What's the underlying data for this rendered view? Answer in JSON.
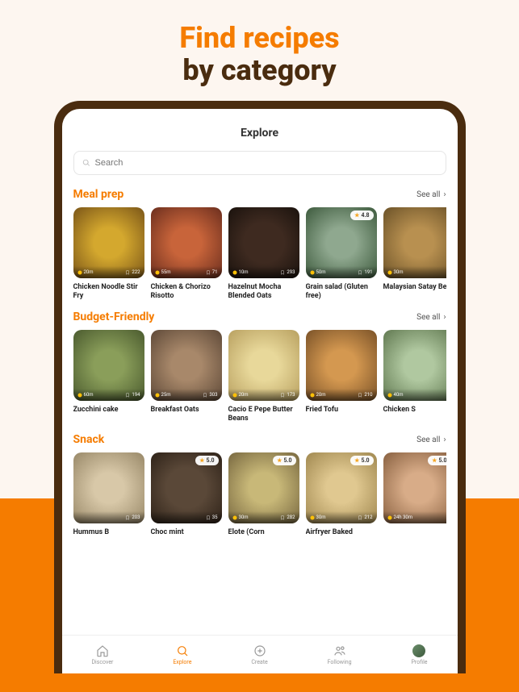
{
  "hero": {
    "line1": "Find recipes",
    "line2": "by category"
  },
  "screenTitle": "Explore",
  "search": {
    "placeholder": "Search"
  },
  "seeAll": "See all",
  "sections": [
    {
      "title": "Meal prep",
      "cards": [
        {
          "title": "Chicken Noodle Stir Fry",
          "time": "20m",
          "saves": "222",
          "rating": "",
          "cls": "f1"
        },
        {
          "title": "Chicken & Chorizo Risotto",
          "time": "55m",
          "saves": "71",
          "rating": "",
          "cls": "f2"
        },
        {
          "title": "Hazelnut Mocha Blended Oats",
          "time": "10m",
          "saves": "293",
          "rating": "",
          "cls": "f3"
        },
        {
          "title": "Grain salad (Gluten free)",
          "time": "50m",
          "saves": "191",
          "rating": "4.8",
          "cls": "f4"
        },
        {
          "title": "Malaysian Satay Bee",
          "time": "30m",
          "saves": "",
          "rating": "",
          "cls": "f5"
        }
      ]
    },
    {
      "title": "Budget-Friendly",
      "cards": [
        {
          "title": "Zucchini cake",
          "time": "60m",
          "saves": "194",
          "rating": "",
          "cls": "f6"
        },
        {
          "title": "Breakfast Oats",
          "time": "25m",
          "saves": "303",
          "rating": "",
          "cls": "f7"
        },
        {
          "title": "Cacio E Pepe Butter Beans",
          "time": "20m",
          "saves": "173",
          "rating": "",
          "cls": "f8"
        },
        {
          "title": "Fried Tofu",
          "time": "20m",
          "saves": "210",
          "rating": "",
          "cls": "f9"
        },
        {
          "title": "Chicken S",
          "time": "40m",
          "saves": "",
          "rating": "",
          "cls": "f10"
        }
      ]
    },
    {
      "title": "Snack",
      "cards": [
        {
          "title": "Hummus B",
          "time": "",
          "saves": "203",
          "rating": "",
          "cls": "f11"
        },
        {
          "title": "Choc mint",
          "time": "",
          "saves": "35",
          "rating": "5.0",
          "cls": "f12"
        },
        {
          "title": "Elote (Corn",
          "time": "30m",
          "saves": "282",
          "rating": "5.0",
          "cls": "f13"
        },
        {
          "title": "Airfryer Baked",
          "time": "30m",
          "saves": "212",
          "rating": "5.0",
          "cls": "f14"
        },
        {
          "title": "",
          "time": "24h 30m",
          "saves": "",
          "rating": "5.0",
          "cls": "f15"
        }
      ]
    }
  ],
  "tabs": [
    {
      "label": "Discover",
      "icon": "home"
    },
    {
      "label": "Explore",
      "icon": "search"
    },
    {
      "label": "Create",
      "icon": "plus"
    },
    {
      "label": "Following",
      "icon": "users"
    },
    {
      "label": "Profile",
      "icon": "avatar"
    }
  ],
  "activeTab": 1
}
